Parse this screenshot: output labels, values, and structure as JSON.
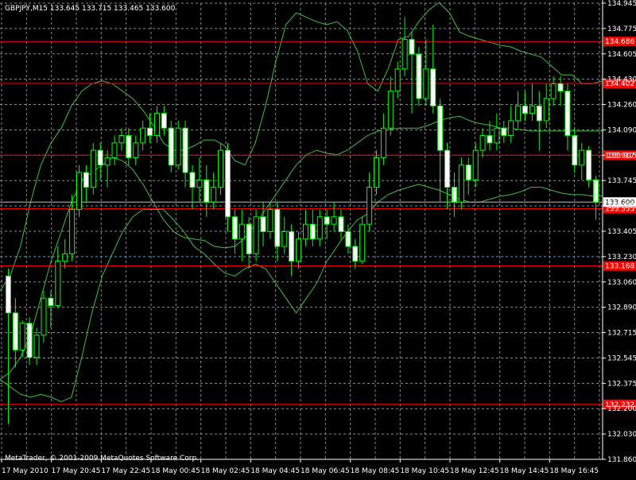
{
  "header": {
    "symbol": "GBPJPY,M15",
    "open": "133.645",
    "high": "133.715",
    "low": "133.465",
    "close": "133.600"
  },
  "footer": {
    "copyright": "MetaTrader, © 2001-2009 MetaQuotes Software Corp."
  },
  "colors": {
    "background": "#000000",
    "grid": "#8a8a8a",
    "axis_text": "#ffffff",
    "bull_body": "#000000",
    "bear_body": "#ffffff",
    "candle_outline": "#00ff00",
    "bands": "#3fbf3f",
    "level_line": "#ff0000",
    "price_tag": "#ffffff"
  },
  "chart_data": {
    "type": "candlestick",
    "ylim": [
      131.86,
      134.945
    ],
    "y_ticks": [
      "134.945",
      "134.775",
      "134.605",
      "134.430",
      "134.260",
      "134.090",
      "133.915",
      "133.745",
      "133.575",
      "133.405",
      "133.230",
      "133.060",
      "132.890",
      "132.715",
      "132.545",
      "132.375",
      "132.200",
      "132.030",
      "131.860"
    ],
    "x_tick_labels": [
      "17 May 2010",
      "17 May 20:45",
      "17 May 22:45",
      "18 May 00:45",
      "18 May 02:45",
      "18 May 04:45",
      "18 May 06:45",
      "18 May 08:45",
      "18 May 10:45",
      "18 May 12:45",
      "18 May 14:45",
      "18 May 16:45"
    ],
    "current_price": "133.600",
    "levels": [
      {
        "value": 134.686,
        "label": "134.686"
      },
      {
        "value": 134.402,
        "label": "134.402"
      },
      {
        "value": 133.917,
        "label": "133.917"
      },
      {
        "value": 133.555,
        "label": "133.555"
      },
      {
        "value": 133.168,
        "label": "133.168"
      },
      {
        "value": 132.232,
        "label": "132.232"
      }
    ],
    "candles": [
      [
        133.1,
        132.85,
        133.15,
        132.1
      ],
      [
        132.85,
        132.6,
        132.95,
        132.48
      ],
      [
        132.6,
        132.78,
        132.8,
        132.55
      ],
      [
        132.78,
        132.55,
        132.82,
        132.5
      ],
      [
        132.55,
        132.7,
        132.75,
        132.5
      ],
      [
        132.7,
        132.95,
        133.0,
        132.65
      ],
      [
        132.95,
        132.9,
        133.0,
        132.75
      ],
      [
        132.9,
        133.2,
        133.3,
        132.88
      ],
      [
        133.2,
        133.25,
        133.35,
        133.15
      ],
      [
        133.25,
        133.55,
        133.65,
        133.2
      ],
      [
        133.55,
        133.8,
        133.85,
        133.5
      ],
      [
        133.8,
        133.7,
        133.85,
        133.6
      ],
      [
        133.7,
        133.95,
        134.0,
        133.65
      ],
      [
        133.95,
        133.85,
        134.0,
        133.75
      ],
      [
        133.85,
        133.9,
        133.95,
        133.7
      ],
      [
        133.9,
        134.0,
        134.05,
        133.85
      ],
      [
        134.0,
        134.05,
        134.1,
        133.95
      ],
      [
        134.05,
        133.9,
        134.1,
        133.85
      ],
      [
        133.9,
        134.0,
        134.05,
        133.85
      ],
      [
        134.0,
        134.1,
        134.15,
        133.95
      ],
      [
        134.1,
        134.05,
        134.2,
        134.0
      ],
      [
        134.05,
        134.2,
        134.25,
        134.0
      ],
      [
        134.2,
        134.1,
        134.25,
        134.05
      ],
      [
        134.1,
        133.85,
        134.15,
        133.8
      ],
      [
        133.85,
        134.1,
        134.15,
        133.82
      ],
      [
        134.1,
        133.8,
        134.15,
        133.7
      ],
      [
        133.8,
        133.7,
        133.85,
        133.55
      ],
      [
        133.7,
        133.75,
        133.9,
        133.6
      ],
      [
        133.75,
        133.6,
        133.85,
        133.5
      ],
      [
        133.6,
        133.7,
        133.8,
        133.55
      ],
      [
        133.7,
        133.95,
        134.0,
        133.65
      ],
      [
        133.95,
        133.5,
        134.0,
        133.4
      ],
      [
        133.5,
        133.35,
        133.55,
        133.25
      ],
      [
        133.35,
        133.45,
        133.55,
        133.2
      ],
      [
        133.45,
        133.25,
        133.5,
        133.15
      ],
      [
        133.25,
        133.5,
        133.55,
        133.2
      ],
      [
        133.5,
        133.4,
        133.6,
        133.3
      ],
      [
        133.4,
        133.55,
        133.6,
        133.35
      ],
      [
        133.55,
        133.3,
        133.6,
        133.2
      ],
      [
        133.3,
        133.4,
        133.5,
        133.25
      ],
      [
        133.4,
        133.2,
        133.45,
        133.1
      ],
      [
        133.2,
        133.35,
        133.4,
        133.15
      ],
      [
        133.35,
        133.45,
        133.55,
        133.3
      ],
      [
        133.45,
        133.35,
        133.55,
        133.3
      ],
      [
        133.35,
        133.5,
        133.55,
        133.3
      ],
      [
        133.5,
        133.45,
        133.55,
        133.35
      ],
      [
        133.45,
        133.5,
        133.6,
        133.4
      ],
      [
        133.5,
        133.4,
        133.55,
        133.35
      ],
      [
        133.4,
        133.3,
        133.45,
        133.25
      ],
      [
        133.3,
        133.2,
        133.35,
        133.15
      ],
      [
        133.2,
        133.45,
        133.5,
        133.18
      ],
      [
        133.45,
        133.7,
        133.8,
        133.4
      ],
      [
        133.7,
        133.9,
        133.95,
        133.65
      ],
      [
        133.9,
        134.1,
        134.2,
        133.85
      ],
      [
        134.1,
        134.35,
        134.45,
        134.05
      ],
      [
        134.35,
        134.5,
        134.55,
        134.3
      ],
      [
        134.5,
        134.7,
        134.85,
        134.45
      ],
      [
        134.7,
        134.6,
        134.75,
        134.2
      ],
      [
        134.6,
        134.3,
        134.65,
        134.25
      ],
      [
        134.3,
        134.5,
        134.7,
        134.25
      ],
      [
        134.5,
        134.25,
        134.8,
        134.2
      ],
      [
        134.25,
        133.95,
        134.3,
        133.6
      ],
      [
        133.95,
        133.7,
        134.0,
        133.55
      ],
      [
        133.7,
        133.6,
        133.8,
        133.5
      ],
      [
        133.6,
        133.85,
        133.9,
        133.55
      ],
      [
        133.85,
        133.75,
        133.9,
        133.65
      ],
      [
        133.75,
        133.95,
        134.0,
        133.7
      ],
      [
        133.95,
        134.05,
        134.1,
        133.9
      ],
      [
        134.05,
        134.0,
        134.15,
        133.95
      ],
      [
        134.0,
        134.1,
        134.2,
        133.95
      ],
      [
        134.1,
        134.05,
        134.15,
        134.0
      ],
      [
        134.05,
        134.15,
        134.25,
        134.0
      ],
      [
        134.15,
        134.25,
        134.35,
        134.1
      ],
      [
        134.25,
        134.2,
        134.35,
        134.15
      ],
      [
        134.2,
        134.25,
        134.4,
        134.15
      ],
      [
        134.25,
        134.15,
        134.35,
        133.95
      ],
      [
        134.15,
        134.3,
        134.4,
        134.1
      ],
      [
        134.3,
        134.4,
        134.45,
        134.25
      ],
      [
        134.4,
        134.35,
        134.45,
        134.25
      ],
      [
        134.35,
        134.05,
        134.4,
        133.95
      ],
      [
        134.05,
        133.85,
        134.1,
        133.8
      ],
      [
        133.85,
        133.95,
        134.0,
        133.75
      ],
      [
        133.95,
        133.75,
        133.98,
        133.7
      ],
      [
        133.75,
        133.6,
        133.78,
        133.48
      ]
    ],
    "bollinger": {
      "upper": [
        133.0,
        133.1,
        133.3,
        133.6,
        133.85,
        134.0,
        134.1,
        134.25,
        134.35,
        134.4,
        134.42,
        134.4,
        134.35,
        134.3,
        134.22,
        134.12,
        134.0,
        133.95,
        133.95,
        133.98,
        134.02,
        134.02,
        133.98,
        133.88,
        133.85,
        134.0,
        134.25,
        134.55,
        134.8,
        134.88,
        134.85,
        134.82,
        134.8,
        134.82,
        134.76,
        134.62,
        134.4,
        134.35,
        134.5,
        134.7,
        134.72,
        134.82,
        134.9,
        134.95,
        134.88,
        134.75,
        134.72,
        134.7,
        134.68,
        134.66,
        134.65,
        134.62,
        134.6,
        134.58,
        134.52,
        134.46,
        134.46,
        134.4,
        134.4,
        134.42
      ],
      "middle": [
        132.4,
        132.45,
        132.55,
        132.7,
        132.95,
        133.2,
        133.4,
        133.6,
        133.75,
        133.8,
        133.85,
        133.9,
        133.88,
        133.82,
        133.72,
        133.6,
        133.48,
        133.4,
        133.36,
        133.35,
        133.34,
        133.3,
        133.29,
        133.3,
        133.36,
        133.45,
        133.55,
        133.65,
        133.75,
        133.85,
        133.92,
        133.95,
        133.93,
        133.92,
        133.95,
        134.0,
        134.05,
        134.08,
        134.09,
        134.1,
        134.1,
        134.1,
        134.12,
        134.15,
        134.17,
        134.18,
        134.15,
        134.13,
        134.12,
        134.1,
        134.1,
        134.09,
        134.08,
        134.08,
        134.08,
        134.08,
        134.08,
        134.08,
        134.08,
        134.08
      ],
      "lower": [
        132.4,
        132.35,
        132.3,
        132.28,
        132.3,
        132.28,
        132.25,
        132.28,
        132.55,
        132.85,
        133.1,
        133.25,
        133.4,
        133.5,
        133.55,
        133.55,
        133.55,
        133.48,
        133.4,
        133.3,
        133.25,
        133.18,
        133.12,
        133.1,
        133.15,
        133.18,
        133.15,
        133.05,
        132.95,
        132.85,
        132.95,
        133.05,
        133.2,
        133.3,
        133.4,
        133.48,
        133.52,
        133.6,
        133.65,
        133.68,
        133.7,
        133.72,
        133.7,
        133.68,
        133.65,
        133.62,
        133.6,
        133.6,
        133.62,
        133.64,
        133.65,
        133.67,
        133.7,
        133.7,
        133.68,
        133.66,
        133.65,
        133.65,
        133.64,
        133.64
      ]
    }
  }
}
